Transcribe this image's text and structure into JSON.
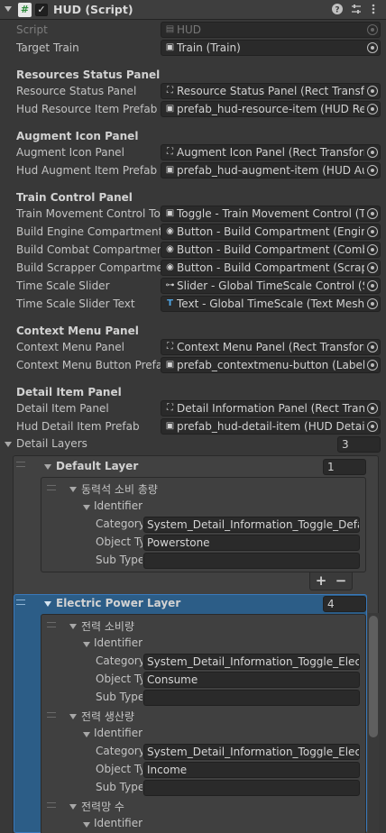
{
  "component": {
    "title": "HUD (Script)",
    "enabled_mark": "✓",
    "script_icon_glyph": "#",
    "help_icon": "question-circle-icon",
    "presets_icon": "sliders-icon",
    "menu_icon": "kebab-menu-icon"
  },
  "props": {
    "script": {
      "label": "Script",
      "value": "HUD"
    },
    "target_train": {
      "label": "Target Train",
      "value": "Train (Train)"
    }
  },
  "sections": {
    "resources": {
      "title": "Resources Status Panel",
      "status_panel": {
        "label": "Resource Status Panel",
        "value": "Resource Status Panel (Rect Transform)"
      },
      "item_prefab": {
        "label": "Hud Resource Item Prefab",
        "value": "prefab_hud-resource-item (HUD Resource Item)"
      }
    },
    "augment": {
      "title": "Augment Icon Panel",
      "icon_panel": {
        "label": "Augment Icon Panel",
        "value": "Augment Icon Panel (Rect Transform)"
      },
      "item_prefab": {
        "label": "Hud Augment Item Prefab",
        "value": "prefab_hud-augment-item (HUD Augment Item)"
      }
    },
    "train_control": {
      "title": "Train Control Panel",
      "movement": {
        "label": "Train Movement Control Toggle",
        "value": "Toggle - Train Movement Control (Toggle)"
      },
      "engine": {
        "label": "Build Engine Compartment Button",
        "value": "Button - Build Compartment (Engine) (Button)"
      },
      "combat": {
        "label": "Build Combat Compartment Button",
        "value": "Button - Build Compartment (Combat) (Button)"
      },
      "scrapper": {
        "label": "Build Scrapper Compartment Button",
        "value": "Button - Build Compartment (Scrapper) (Button)"
      },
      "timescale_slider": {
        "label": "Time Scale Slider",
        "value": "Slider - Global TimeScale Control (Slider)"
      },
      "timescale_text": {
        "label": "Time Scale Slider Text",
        "value": "Text - Global TimeScale (Text Mesh Pro UGUI)"
      }
    },
    "context_menu": {
      "title": "Context Menu Panel",
      "panel": {
        "label": "Context Menu Panel",
        "value": "Context Menu Panel (Rect Transform)"
      },
      "button_prefab": {
        "label": "Context Menu Button Prefab",
        "value": "prefab_contextmenu-button (Labeled Button)"
      }
    },
    "detail_item": {
      "title": "Detail Item Panel",
      "panel": {
        "label": "Detail Item Panel",
        "value": "Detail Information Panel (Rect Transform)"
      },
      "item_prefab": {
        "label": "Hud Detail Item Prefab",
        "value": "prefab_hud-detail-item (HUD Detail Item)"
      }
    }
  },
  "detail_layers": {
    "label": "Detail Layers",
    "count": "3",
    "identifier_label": "Identifier",
    "category_label": "Category",
    "object_type_label": "Object Type",
    "sub_type_label": "Sub Type",
    "layers": [
      {
        "name": "Default Layer",
        "count": "1",
        "items": [
          {
            "name": "동력석 소비 총량",
            "category": "System_Detail_Information_Toggle_Default",
            "object_type": "Powerstone",
            "sub_type": ""
          }
        ]
      },
      {
        "name": "Electric Power Layer",
        "count": "4",
        "items": [
          {
            "name": "전력 소비량",
            "category": "System_Detail_Information_Toggle_Electric",
            "object_type": "Consume",
            "sub_type": ""
          },
          {
            "name": "전력 생산량",
            "category": "System_Detail_Information_Toggle_Electric",
            "object_type": "Income",
            "sub_type": ""
          },
          {
            "name": "전력망 수",
            "category": "",
            "object_type": "",
            "sub_type": ""
          }
        ]
      }
    ],
    "add_glyph": "+",
    "remove_glyph": "−"
  },
  "colors": {
    "selection": "#2c5d87",
    "selection_border": "#3a79bb"
  }
}
